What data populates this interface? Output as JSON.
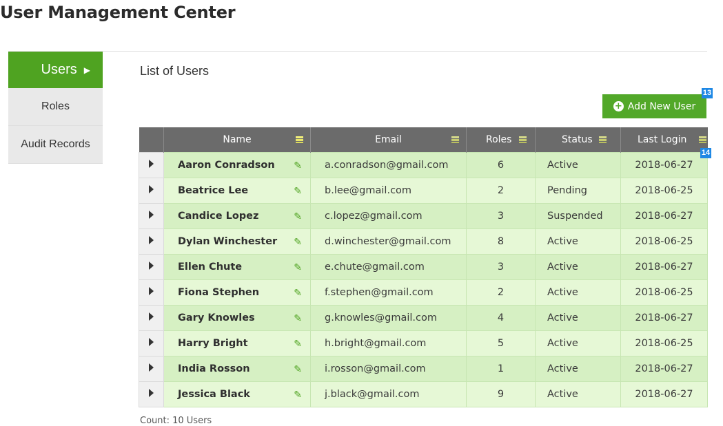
{
  "page": {
    "title": "User Management Center"
  },
  "sidebar": {
    "items": [
      {
        "label": "Users",
        "active": true
      },
      {
        "label": "Roles",
        "active": false
      },
      {
        "label": "Audit Records",
        "active": false
      }
    ]
  },
  "main": {
    "section_title": "List of Users",
    "add_button_label": "Add New User",
    "badges": {
      "add_button": "13",
      "table_corner": "14"
    }
  },
  "table": {
    "columns": [
      "Name",
      "Email",
      "Roles",
      "Status",
      "Last Login"
    ],
    "rows": [
      {
        "name": "Aaron Conradson",
        "email": "a.conradson@gmail.com",
        "roles": "6",
        "status": "Active",
        "last_login": "2018-06-27"
      },
      {
        "name": "Beatrice Lee",
        "email": "b.lee@gmail.com",
        "roles": "2",
        "status": "Pending",
        "last_login": "2018-06-25"
      },
      {
        "name": "Candice Lopez",
        "email": "c.lopez@gmail.com",
        "roles": "3",
        "status": "Suspended",
        "last_login": "2018-06-27"
      },
      {
        "name": "Dylan Winchester",
        "email": "d.winchester@gmail.com",
        "roles": "8",
        "status": "Active",
        "last_login": "2018-06-25"
      },
      {
        "name": "Ellen Chute",
        "email": "e.chute@gmail.com",
        "roles": "3",
        "status": "Active",
        "last_login": "2018-06-27"
      },
      {
        "name": "Fiona Stephen",
        "email": "f.stephen@gmail.com",
        "roles": "2",
        "status": "Active",
        "last_login": "2018-06-25"
      },
      {
        "name": "Gary Knowles",
        "email": "g.knowles@gmail.com",
        "roles": "4",
        "status": "Active",
        "last_login": "2018-06-27"
      },
      {
        "name": "Harry Bright",
        "email": "h.bright@gmail.com",
        "roles": "5",
        "status": "Active",
        "last_login": "2018-06-25"
      },
      {
        "name": "India Rosson",
        "email": "i.rosson@gmail.com",
        "roles": "1",
        "status": "Active",
        "last_login": "2018-06-27"
      },
      {
        "name": "Jessica Black",
        "email": "j.black@gmail.com",
        "roles": "9",
        "status": "Active",
        "last_login": "2018-06-27"
      }
    ],
    "count_label": "Count: 10 Users"
  },
  "colors": {
    "accent_green": "#4fa321",
    "header_gray": "#6b6b6b",
    "row_odd": "#d6f0c3",
    "row_even": "#e6f8d6",
    "badge_blue": "#1e88e5"
  },
  "icons": [
    "caret-right-icon",
    "plus-circle-icon",
    "pencil-icon",
    "column-filter-icon"
  ]
}
